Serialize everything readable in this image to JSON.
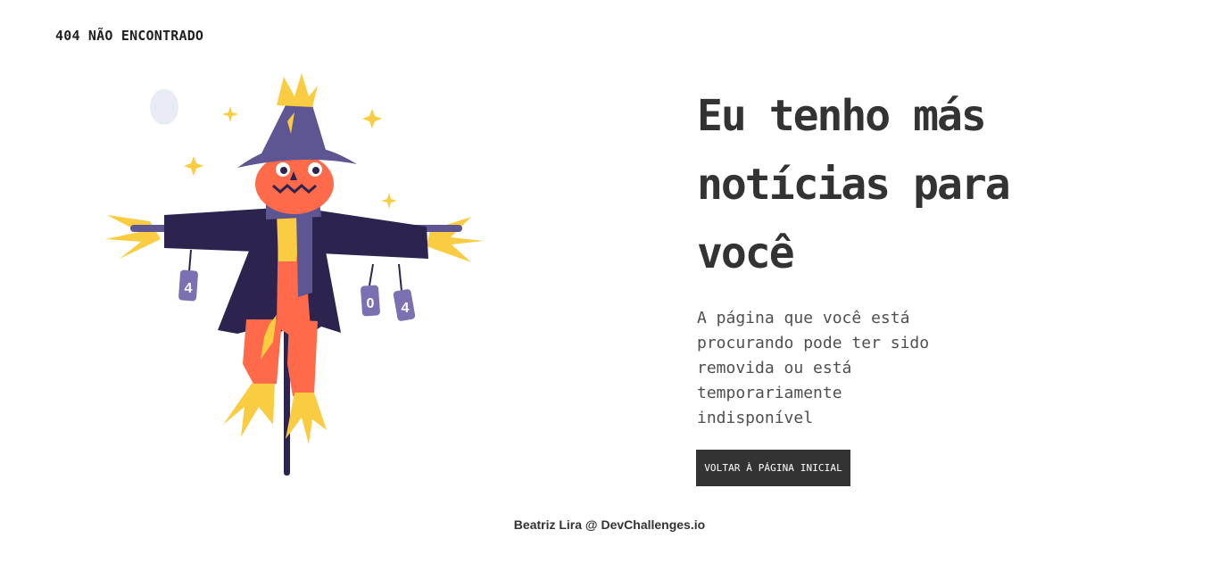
{
  "header": {
    "title": "404 NÃO ENCONTRADO"
  },
  "main": {
    "headline": "Eu tenho más notícias para você",
    "description": "A página que você está procurando pode ter sido removida ou está temporariamente indisponível",
    "button_label": "VOLTAR À PÁGINA INICIAL"
  },
  "illustration": {
    "icon": "scarecrow-illustration-icon",
    "can_labels": [
      "4",
      "0",
      "4"
    ]
  },
  "footer": {
    "credit": "Beatriz Lira @ DevChallenges.io"
  },
  "colors": {
    "text_dark": "#333333",
    "button_bg": "#333333",
    "button_text": "#ffffff",
    "hat": "#5e5593",
    "coat": "#2c244f",
    "pumpkin": "#ff6b4a",
    "straw": "#f9cc41"
  }
}
